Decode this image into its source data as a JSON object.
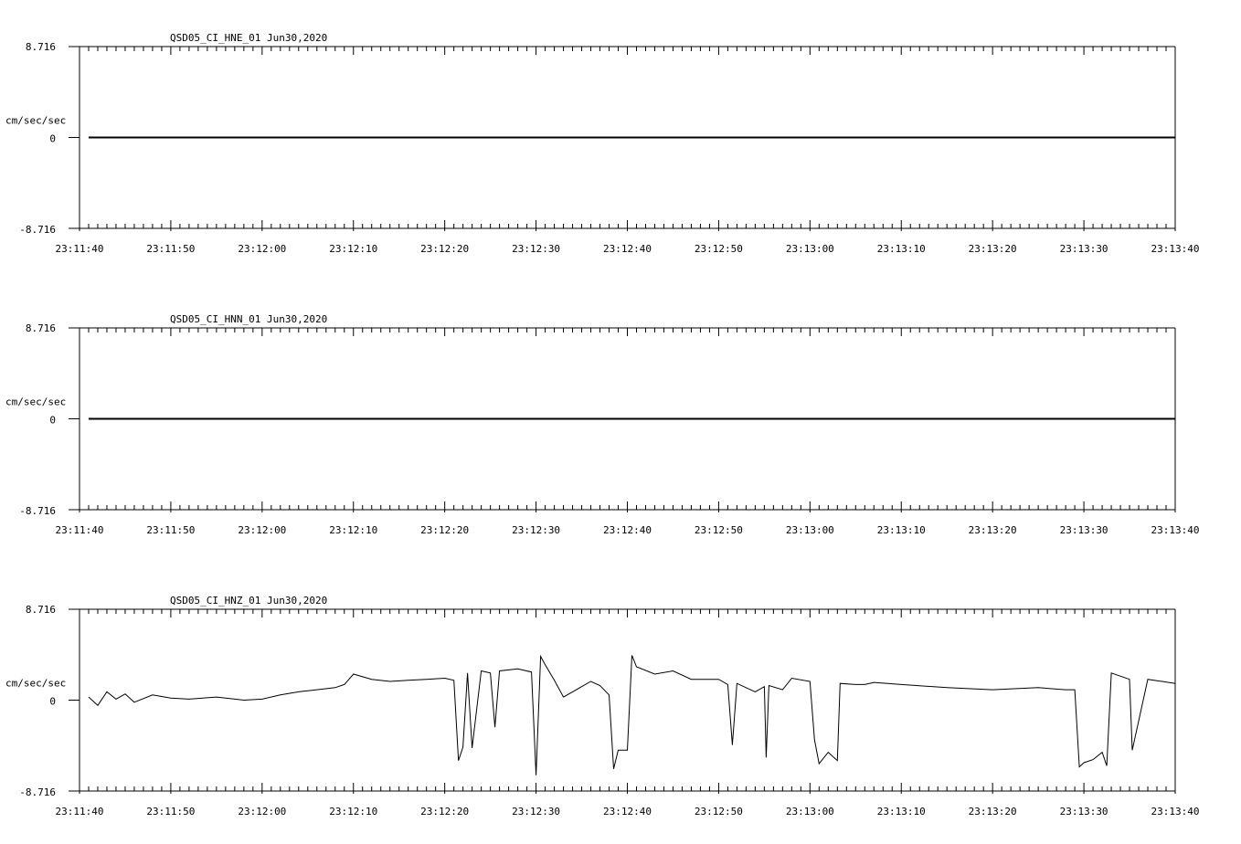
{
  "chart_data": [
    {
      "type": "line",
      "title": "QSD05_CI_HNE_01  Jun30,2020",
      "ylabel": "cm/sec/sec",
      "ylim": [
        -8.716,
        8.716
      ],
      "ytick_labels": [
        "8.716",
        "0",
        "-8.716"
      ],
      "xlim": [
        "23:11:40",
        "23:13:40"
      ],
      "xtick_labels": [
        "23:11:40",
        "23:11:50",
        "23:12:00",
        "23:12:10",
        "23:12:20",
        "23:12:30",
        "23:12:40",
        "23:12:50",
        "23:13:00",
        "23:13:10",
        "23:13:20",
        "23:13:30",
        "23:13:40"
      ],
      "series": [
        {
          "x": [
            "23:11:41",
            "23:13:40"
          ],
          "values": [
            0,
            0
          ]
        }
      ]
    },
    {
      "type": "line",
      "title": "QSD05_CI_HNN_01  Jun30,2020",
      "ylabel": "cm/sec/sec",
      "ylim": [
        -8.716,
        8.716
      ],
      "ytick_labels": [
        "8.716",
        "0",
        "-8.716"
      ],
      "xlim": [
        "23:11:40",
        "23:13:40"
      ],
      "xtick_labels": [
        "23:11:40",
        "23:11:50",
        "23:12:00",
        "23:12:10",
        "23:12:20",
        "23:12:30",
        "23:12:40",
        "23:12:50",
        "23:13:00",
        "23:13:10",
        "23:13:20",
        "23:13:30",
        "23:13:40"
      ],
      "series": [
        {
          "x": [
            "23:11:41",
            "23:13:40"
          ],
          "values": [
            0,
            0
          ]
        }
      ]
    },
    {
      "type": "line",
      "title": "QSD05_CI_HNZ_01  Jun30,2020",
      "ylabel": "cm/sec/sec",
      "ylim": [
        -8.716,
        8.716
      ],
      "ytick_labels": [
        "8.716",
        "0",
        "-8.716"
      ],
      "xlim": [
        "23:11:40",
        "23:13:40"
      ],
      "xtick_labels": [
        "23:11:40",
        "23:11:50",
        "23:12:00",
        "23:12:10",
        "23:12:20",
        "23:12:30",
        "23:12:40",
        "23:12:50",
        "23:13:00",
        "23:13:10",
        "23:13:20",
        "23:13:30",
        "23:13:40"
      ],
      "series": [
        {
          "x": [
            "23:11:41",
            "23:11:42",
            "23:11:43",
            "23:11:44",
            "23:11:45",
            "23:11:46",
            "23:11:48",
            "23:11:50",
            "23:11:52",
            "23:11:55",
            "23:11:58",
            "23:12:00",
            "23:12:02",
            "23:12:04",
            "23:12:06",
            "23:12:08",
            "23:12:09",
            "23:12:10",
            "23:12:12",
            "23:12:14",
            "23:12:16",
            "23:12:18",
            "23:12:20",
            "23:12:21",
            "23:12:21.5",
            "23:12:22",
            "23:12:22.5",
            "23:12:23",
            "23:12:24",
            "23:12:25",
            "23:12:25.5",
            "23:12:26",
            "23:12:28",
            "23:12:29.5",
            "23:12:30",
            "23:12:30.5",
            "23:12:31",
            "23:12:32",
            "23:12:33",
            "23:12:34",
            "23:12:35",
            "23:12:36",
            "23:12:37",
            "23:12:38",
            "23:12:38.5",
            "23:12:39",
            "23:12:40",
            "23:12:40.5",
            "23:12:41",
            "23:12:43",
            "23:12:45",
            "23:12:47",
            "23:12:48",
            "23:12:50",
            "23:12:51",
            "23:12:51.5",
            "23:12:52",
            "23:12:54",
            "23:12:55",
            "23:12:55.2",
            "23:12:55.5",
            "23:12:57",
            "23:12:58",
            "23:13:00",
            "23:13:00.5",
            "23:13:01",
            "23:13:02",
            "23:13:03",
            "23:13:03.3",
            "23:13:05",
            "23:13:06",
            "23:13:07",
            "23:13:10",
            "23:13:15",
            "23:13:20",
            "23:13:25",
            "23:13:28",
            "23:13:29",
            "23:13:29.5",
            "23:13:30",
            "23:13:31",
            "23:13:32",
            "23:13:32.5",
            "23:13:33",
            "23:13:35",
            "23:13:35.3",
            "23:13:37",
            "23:13:40"
          ],
          "values": [
            0.3,
            -0.5,
            0.8,
            0.1,
            0.6,
            -0.2,
            0.5,
            0.2,
            0.1,
            0.3,
            0.0,
            0.1,
            0.5,
            0.8,
            1.0,
            1.2,
            1.5,
            2.5,
            2.0,
            1.8,
            1.9,
            2.0,
            2.1,
            1.9,
            -5.8,
            -4.5,
            2.6,
            -4.6,
            2.8,
            2.6,
            -2.6,
            2.8,
            3.0,
            2.7,
            -7.2,
            4.2,
            3.4,
            1.9,
            0.3,
            0.8,
            1.3,
            1.8,
            1.4,
            0.5,
            -6.6,
            -4.8,
            -4.8,
            4.3,
            3.2,
            2.5,
            2.8,
            2.0,
            2.0,
            2.0,
            1.5,
            -4.3,
            1.6,
            0.8,
            1.3,
            -5.5,
            1.4,
            1.0,
            2.1,
            1.8,
            -3.8,
            -6.1,
            -5.0,
            -5.8,
            1.6,
            1.5,
            1.5,
            1.7,
            1.5,
            1.2,
            1.0,
            1.2,
            1.0,
            1.0,
            -6.4,
            -6.0,
            -5.7,
            -5.0,
            -6.3,
            2.6,
            2.0,
            -4.8,
            2.0,
            1.6
          ]
        }
      ]
    }
  ]
}
